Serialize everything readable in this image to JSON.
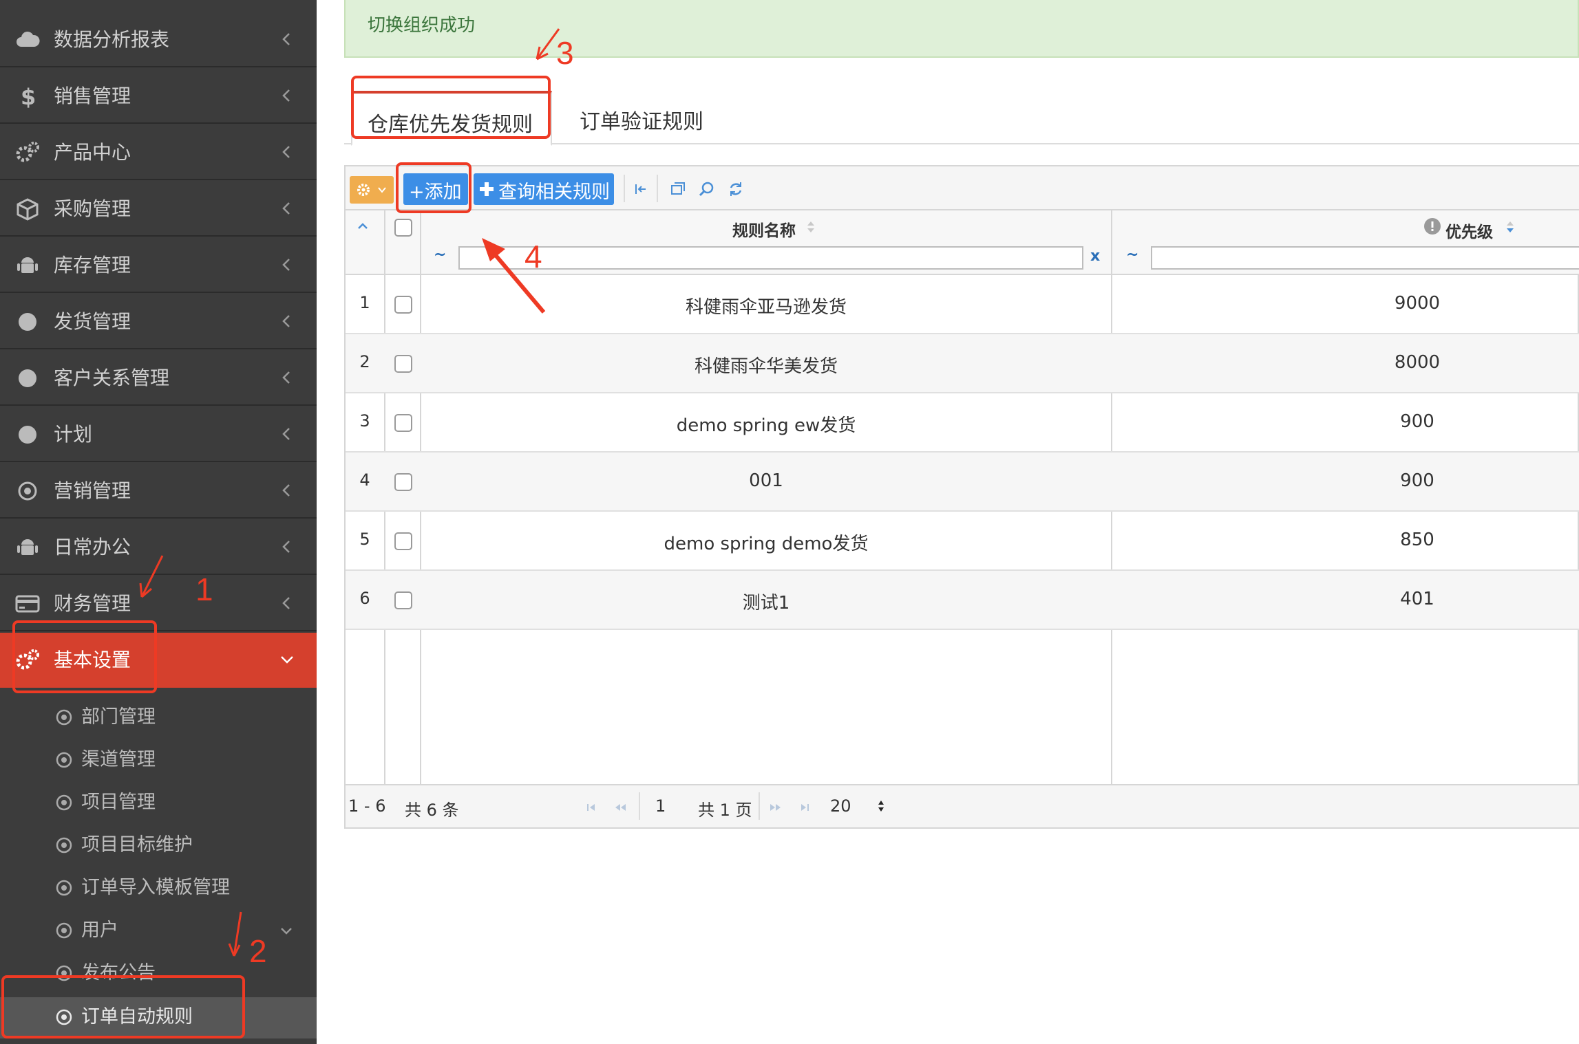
{
  "sidebar": {
    "menu": [
      {
        "label": "数据分析报表",
        "icon": "cloud-icon"
      },
      {
        "label": "销售管理",
        "icon": "dollar-icon"
      },
      {
        "label": "产品中心",
        "icon": "gears-icon"
      },
      {
        "label": "采购管理",
        "icon": "cube-icon"
      },
      {
        "label": "库存管理",
        "icon": "android-icon"
      },
      {
        "label": "发货管理",
        "icon": "circle-icon"
      },
      {
        "label": "客户关系管理",
        "icon": "circle-icon"
      },
      {
        "label": "计划",
        "icon": "circle-icon"
      },
      {
        "label": "营销管理",
        "icon": "dot-circle-icon"
      },
      {
        "label": "日常办公",
        "icon": "android-icon"
      },
      {
        "label": "财务管理",
        "icon": "credit-card-icon"
      },
      {
        "label": "基本设置",
        "icon": "gears-icon"
      }
    ],
    "submenu": [
      {
        "label": "部门管理"
      },
      {
        "label": "渠道管理"
      },
      {
        "label": "项目管理"
      },
      {
        "label": "项目目标维护"
      },
      {
        "label": "订单导入模板管理"
      },
      {
        "label": "用户"
      },
      {
        "label": "发布公告"
      },
      {
        "label": "订单自动规则"
      }
    ]
  },
  "alert": {
    "text": "切换组织成功"
  },
  "tabs": [
    {
      "label": "仓库优先发货规则"
    },
    {
      "label": "订单验证规则"
    }
  ],
  "toolbar": {
    "add_label": "+添加",
    "query_label": "查询相关规则"
  },
  "table": {
    "headers": {
      "name": "规则名称",
      "priority": "优先级"
    },
    "filter_prefix": "~",
    "filter_clear": "x",
    "rows": [
      {
        "n": "1",
        "name": "科健雨伞亚马逊发货",
        "priority": "9000"
      },
      {
        "n": "2",
        "name": "科健雨伞华美发货",
        "priority": "8000"
      },
      {
        "n": "3",
        "name": "demo spring ew发货",
        "priority": "900"
      },
      {
        "n": "4",
        "name": "001",
        "priority": "900"
      },
      {
        "n": "5",
        "name": "demo spring demo发货",
        "priority": "850"
      },
      {
        "n": "6",
        "name": "测试1",
        "priority": "401"
      }
    ]
  },
  "pager": {
    "range": "1 - 6",
    "total": "共 6 条",
    "page": "1",
    "pages": "共 1 页",
    "page_size": "20"
  },
  "annotations": [
    "1",
    "2",
    "3",
    "4"
  ],
  "colors": {
    "sidebar_bg": "#3c3c3c",
    "active_menu": "#d5402d",
    "primary_button": "#3c8ee6",
    "gear_button": "#f0ad4e",
    "alert_bg": "#dff0d8",
    "annotation": "#ee3a24"
  }
}
